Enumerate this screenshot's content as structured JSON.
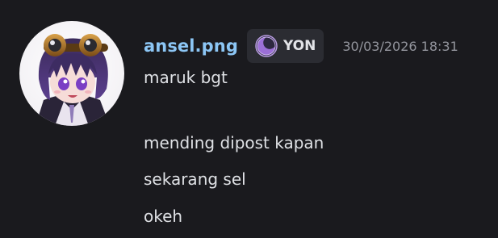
{
  "message": {
    "username": "ansel.png",
    "clan_tag": {
      "label": "YON",
      "icon": "crescent-moon-icon"
    },
    "timestamp": "30/03/2026 18:31",
    "lines": [
      "maruk bgt",
      "mending dipost kapan",
      "sekarang sel",
      "okeh"
    ]
  },
  "colors": {
    "background": "#1a1a1e",
    "username": "#8cc6f5",
    "tag_background": "#2b2c32",
    "tag_icon": "#9b6fd6",
    "timestamp": "#93959d",
    "text": "#dfe1e5"
  }
}
